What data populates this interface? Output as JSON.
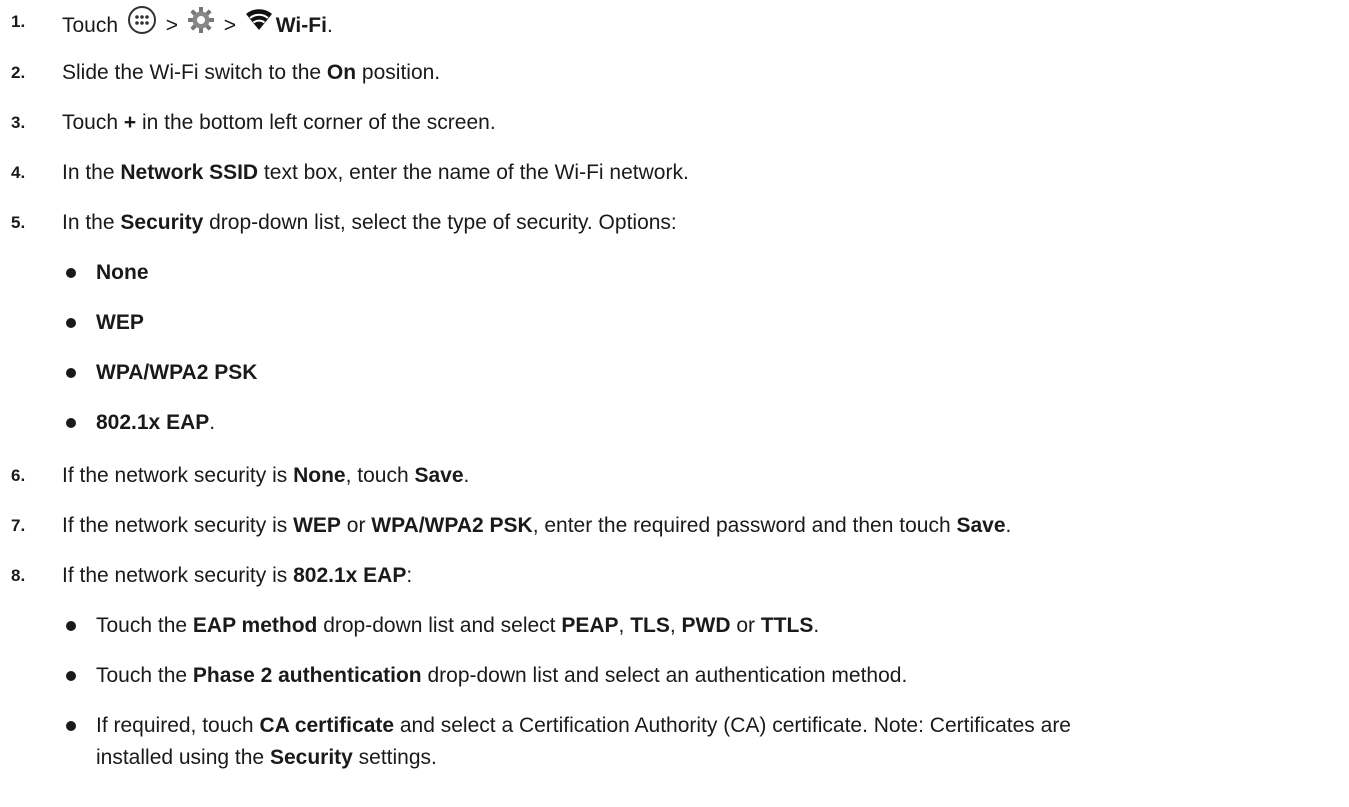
{
  "steps": [
    {
      "number": "1.",
      "parts": [
        "Touch",
        ">",
        ">",
        "Wi-Fi",
        "."
      ]
    },
    {
      "number": "2.",
      "parts": [
        "Slide the Wi-Fi switch to the ",
        "On",
        " position."
      ]
    },
    {
      "number": "3.",
      "parts": [
        "Touch ",
        "+",
        " in the bottom left corner of the screen."
      ]
    },
    {
      "number": "4.",
      "parts": [
        "In the ",
        "Network SSID",
        " text box, enter the name of the Wi-Fi network."
      ]
    },
    {
      "number": "5.",
      "parts": [
        "In the ",
        "Security",
        " drop-down list, select the type of security. Options:"
      ],
      "options": [
        "None",
        "WEP",
        "WPA/WPA2 PSK",
        "802.1x EAP",
        "."
      ]
    },
    {
      "number": "6.",
      "parts": [
        "If the network security is ",
        "None",
        ", touch ",
        "Save",
        "."
      ]
    },
    {
      "number": "7.",
      "parts": [
        "If the network security is ",
        "WEP",
        " or ",
        "WPA/WPA2 PSK",
        ", enter the required password and then touch ",
        "Save",
        "."
      ]
    },
    {
      "number": "8.",
      "parts": [
        "If the network security is ",
        "802.1x EAP",
        ":"
      ],
      "bullets": [
        [
          "Touch the ",
          "EAP method",
          " drop-down list and select ",
          "PEAP",
          ", ",
          "TLS",
          ", ",
          "PWD",
          " or ",
          "TTLS",
          "."
        ],
        [
          "Touch the ",
          "Phase 2 authentication",
          " drop-down list and select an authentication method."
        ],
        [
          "If required, touch ",
          "CA certificate",
          " and select a Certification Authority (CA) certificate. Note: Certificates are"
        ],
        [
          "installed using the ",
          "Security",
          " settings."
        ]
      ]
    }
  ],
  "icons": [
    "apps-icon",
    "settings-gear-icon",
    "wifi-icon"
  ]
}
